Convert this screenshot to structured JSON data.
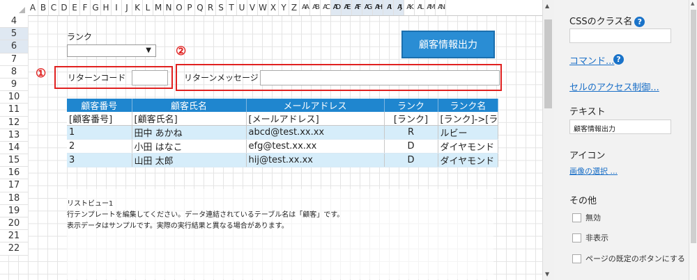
{
  "sheet": {
    "columns": [
      "A",
      "B",
      "C",
      "D",
      "E",
      "F",
      "G",
      "H",
      "I",
      "J",
      "K",
      "L",
      "M",
      "N",
      "O",
      "P",
      "Q",
      "R",
      "S",
      "T",
      "U",
      "V",
      "W",
      "X",
      "Y",
      "Z",
      "AA",
      "AB",
      "AC",
      "AD",
      "AE",
      "AF",
      "AG",
      "AH",
      "AI",
      "AJ",
      "AK",
      "AL",
      "AM",
      "AN"
    ],
    "rows": [
      "4",
      "5",
      "6",
      "7",
      "8",
      "9",
      "10",
      "11",
      "12",
      "13",
      "14",
      "15",
      "16",
      "17",
      "18",
      "19",
      "20",
      "21",
      "22"
    ],
    "rank_label": "ランク",
    "export_button": "顧客情報出力",
    "marker_1": "①",
    "marker_2": "②",
    "return_code_label": "リターンコード",
    "return_message_label": "リターンメッセージ",
    "list": {
      "headers": [
        "顧客番号",
        "顧客氏名",
        "メールアドレス",
        "ランク",
        "ランク名"
      ],
      "template_row": [
        "[顧客番号]",
        "[顧客氏名]",
        "[メールアドレス]",
        "[ランク]",
        "[ランク]->[ラ"
      ],
      "rows": [
        [
          "1",
          "田中 あかね",
          "abcd@test.xx.xx",
          "R",
          "ルビー"
        ],
        [
          "2",
          "小田 はなこ",
          "efg@test.xx.xx",
          "D",
          "ダイヤモンド"
        ],
        [
          "3",
          "山田 太郎",
          "hij@test.xx.xx",
          "D",
          "ダイヤモンド"
        ]
      ]
    },
    "notes": [
      "リストビュー1",
      "行テンプレートを編集してください。データ連結されているテーブル名は「顧客」です。",
      "表示データはサンプルです。実際の実行結果と異なる場合があります。"
    ]
  },
  "panel": {
    "css_class_label": "CSSのクラス名",
    "css_class_value": "",
    "command_link": "コマンド...",
    "access_link": "セルのアクセス制御...",
    "text_label": "テキスト",
    "text_value": "顧客情報出力",
    "icon_label": "アイコン",
    "image_select_link": "画像の選択 ...",
    "other_label": "その他",
    "checkboxes": [
      "無効",
      "非表示",
      "ページの既定のボタンにする"
    ]
  },
  "colors": {
    "accent": "#1f86cf",
    "highlight_box": "#e0201f",
    "link": "#1a6fc7"
  }
}
